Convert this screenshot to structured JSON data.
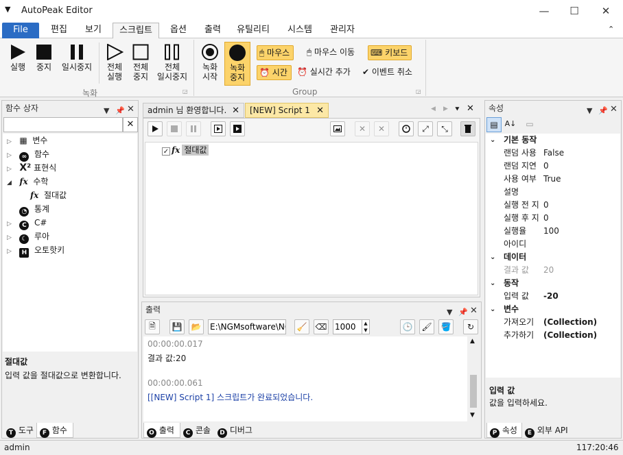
{
  "app": {
    "title": "AutoPeak Editor"
  },
  "ribbon_tabs": [
    {
      "label": "File"
    },
    {
      "label": "편집"
    },
    {
      "label": "보기"
    },
    {
      "label": "스크립트"
    },
    {
      "label": "옵션"
    },
    {
      "label": "출력"
    },
    {
      "label": "유틸리티"
    },
    {
      "label": "시스템"
    },
    {
      "label": "관리자"
    }
  ],
  "ribbon": {
    "run": "실행",
    "stop": "중지",
    "pause": "일시중지",
    "run_all_1": "전체",
    "run_all_2": "실행",
    "stop_all_1": "전체",
    "stop_all_2": "중지",
    "pause_all_1": "전체",
    "pause_all_2": "일시중지",
    "record_start_1": "녹화",
    "record_start_2": "시작",
    "record_stop_1": "녹화",
    "record_stop_2": "중지",
    "group_record": "녹화",
    "mouse": "마우스",
    "mouse_move": "마우스 이동",
    "keyboard": "키보드",
    "time": "시간",
    "realtime_add": "실시간 추가",
    "event_cancel": "이벤트 취소",
    "group_group": "Group"
  },
  "left_panel": {
    "title": "함수 상자",
    "search_value": "",
    "tree": [
      {
        "label": "변수",
        "icon": "variable-icon",
        "expanded": false
      },
      {
        "label": "함수",
        "icon": "function-icon",
        "expanded": false
      },
      {
        "label": "표현식",
        "icon": "expression-icon",
        "expanded": false
      },
      {
        "label": "수학",
        "icon": "math-icon",
        "expanded": true
      },
      {
        "label": "절대값",
        "icon": "fx-icon",
        "child": true
      },
      {
        "label": "통계",
        "icon": "statistics-icon",
        "expanded": false
      },
      {
        "label": "C#",
        "icon": "csharp-icon",
        "expanded": false
      },
      {
        "label": "루아",
        "icon": "lua-icon",
        "expanded": false
      },
      {
        "label": "오토핫키",
        "icon": "autohotkey-icon",
        "expanded": false
      }
    ],
    "desc_title": "절대값",
    "desc_text": "입력 값을 절대값으로 변환합니다.",
    "tabs": [
      {
        "label": "도구",
        "badge": "T"
      },
      {
        "label": "함수",
        "badge": "F"
      }
    ]
  },
  "editor": {
    "tabs": [
      {
        "label": "admin 님 환영합니다."
      },
      {
        "label": "[NEW] Script 1"
      }
    ],
    "node_label": "절대값",
    "node_checked": true
  },
  "output": {
    "title": "출력",
    "path": "E:\\NGMsoftware\\NG",
    "count": "1000",
    "lines": [
      {
        "text": "00:00:00.017",
        "kind": "time"
      },
      {
        "text": "결과 값:20",
        "kind": "normal"
      },
      {
        "text": "",
        "kind": "normal"
      },
      {
        "text": "00:00:00.061",
        "kind": "time"
      },
      {
        "text": "[[NEW] Script 1] 스크립트가 완료되었습니다.",
        "kind": "info"
      }
    ],
    "tabs": [
      {
        "label": "출력",
        "badge": "O"
      },
      {
        "label": "콘솔",
        "badge": "C"
      },
      {
        "label": "디버그",
        "badge": "D"
      }
    ]
  },
  "properties": {
    "title": "속성",
    "categories": [
      {
        "name": "기본 동작",
        "rows": [
          {
            "name": "랜덤 사용",
            "value": "False"
          },
          {
            "name": "랜덤 지연",
            "value": "0"
          },
          {
            "name": "사용 여부",
            "value": "True"
          },
          {
            "name": "설명",
            "value": ""
          },
          {
            "name": "실행 전 지",
            "value": "0"
          },
          {
            "name": "실행 후 지",
            "value": "0"
          },
          {
            "name": "실행율",
            "value": "100"
          },
          {
            "name": "아이디",
            "value": ""
          }
        ]
      },
      {
        "name": "데이터",
        "rows": [
          {
            "name": "결과 값",
            "value": "20",
            "dim": true
          }
        ]
      },
      {
        "name": "동작",
        "rows": [
          {
            "name": "입력 값",
            "value": "-20",
            "bold": true
          }
        ]
      },
      {
        "name": "변수",
        "rows": [
          {
            "name": "가져오기",
            "value": "(Collection)",
            "bold": true
          },
          {
            "name": "추가하기",
            "value": "(Collection)",
            "bold": true
          }
        ]
      }
    ],
    "desc_title": "입력 값",
    "desc_text": "값을 입력하세요.",
    "tabs": [
      {
        "label": "속성",
        "badge": "P"
      },
      {
        "label": "외부 API",
        "badge": "E"
      }
    ]
  },
  "status": {
    "user": "admin",
    "time": "117:20:46"
  }
}
